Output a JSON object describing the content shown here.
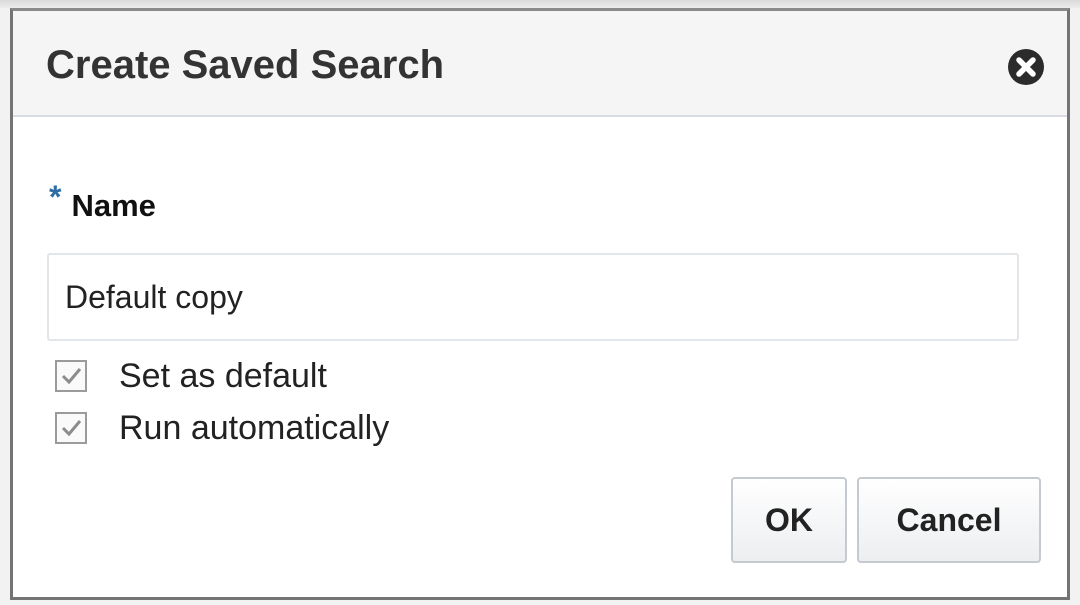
{
  "dialog": {
    "title": "Create Saved Search",
    "close_icon": "close-circle-icon"
  },
  "name_field": {
    "required_marker": "*",
    "label": "Name",
    "value": "Default copy"
  },
  "options": [
    {
      "label": "Set as default",
      "checked": true
    },
    {
      "label": "Run automatically",
      "checked": true
    }
  ],
  "buttons": {
    "ok_label": "OK",
    "cancel_label": "Cancel"
  },
  "colors": {
    "required_star": "#2e6ea4",
    "header_bg": "#f5f5f5",
    "border": "#747474"
  }
}
